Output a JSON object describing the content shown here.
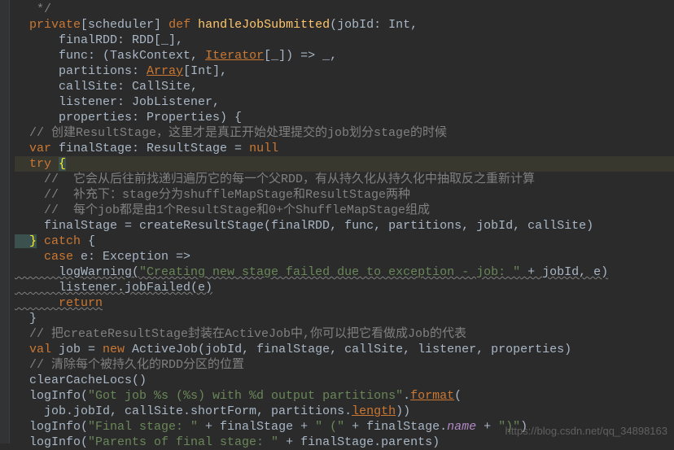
{
  "code": {
    "l01a": "   */",
    "l02_kw1": "private",
    "l02_txt1": "[scheduler] ",
    "l02_kw2": "def ",
    "l02_fn": "handleJobSubmitted",
    "l02_txt2": "(jobId: Int,",
    "l03_txt": "    finalRDD: RDD[_],",
    "l04_txt1": "    func: (TaskContext, ",
    "l04_it": "Iterator",
    "l04_txt2": "[_]) => _,",
    "l05_txt1": "    partitions: ",
    "l05_arr": "Array",
    "l05_txt2": "[Int],",
    "l06_txt": "    callSite: CallSite,",
    "l07_txt": "    listener: JobListener,",
    "l08_txt": "    properties: Properties) {",
    "l09_c": "  // 创建ResultStage，这里才是真正开始处理提交的job划分stage的时候",
    "l10_kw": "  var ",
    "l10_txt": "finalStage: ResultStage = ",
    "l10_null": "null",
    "l11_kw": "  try ",
    "l11_brace": "{",
    "l12_c": "    //  它会从后往前找递归遍历它的每一个父RDD，有从持久化从持久化中抽取反之重新计算",
    "l13_c": "    //  补充下：stage分为shuffleMapStage和ResultStage两种",
    "l14_c": "    //  每个job都是由1个ResultStage和0+个ShuffleMapStage组成",
    "l15_txt": "    finalStage = createResultStage(finalRDD, func, partitions, jobId, callSite)",
    "l16_brace": "  }",
    "l16_kw": " catch ",
    "l16_txt": "{",
    "l17_kw": "    case ",
    "l17_txt": "e: Exception =>",
    "l18_txt1": "      logWarning(",
    "l18_str": "\"Creating new stage failed due to exception - job: \"",
    "l18_txt2": " + jobId, e)",
    "l19_txt": "      listener.jobFailed(e)",
    "l20_kw": "      return",
    "l21_txt": "  }",
    "l22_c": "  // 把createResultStage封装在ActiveJob中,你可以把它看做成Job的代表",
    "l23_kw1": "  val ",
    "l23_txt1": "job = ",
    "l23_kw2": "new ",
    "l23_txt2": "ActiveJob(jobId, finalStage, callSite, listener, properties)",
    "l24_c": "  // 清除每个被持久化的RDD分区的位置",
    "l25_txt": "  clearCacheLocs()",
    "l26_txt1": "  logInfo(",
    "l26_str": "\"Got job %s (%s) with %d output partitions\"",
    "l26_txt2": ".",
    "l26_fmt": "format",
    "l26_txt3": "(",
    "l27_txt1": "    job.jobId, callSite.shortForm, partitions.",
    "l27_len": "length",
    "l27_txt2": "))",
    "l28_txt1": "  logInfo(",
    "l28_str1": "\"Final stage: \"",
    "l28_txt2": " + finalStage + ",
    "l28_str2": "\" (\"",
    "l28_txt3": " + finalStage.",
    "l28_name": "name",
    "l28_txt4": " + ",
    "l28_str3": "\")\"",
    "l28_txt5": ")",
    "l29_txt1": "  logInfo(",
    "l29_str": "\"Parents of final stage: \"",
    "l29_txt2": " + finalStage.parents)"
  },
  "watermark": "https://blog.csdn.net/qq_34898163"
}
